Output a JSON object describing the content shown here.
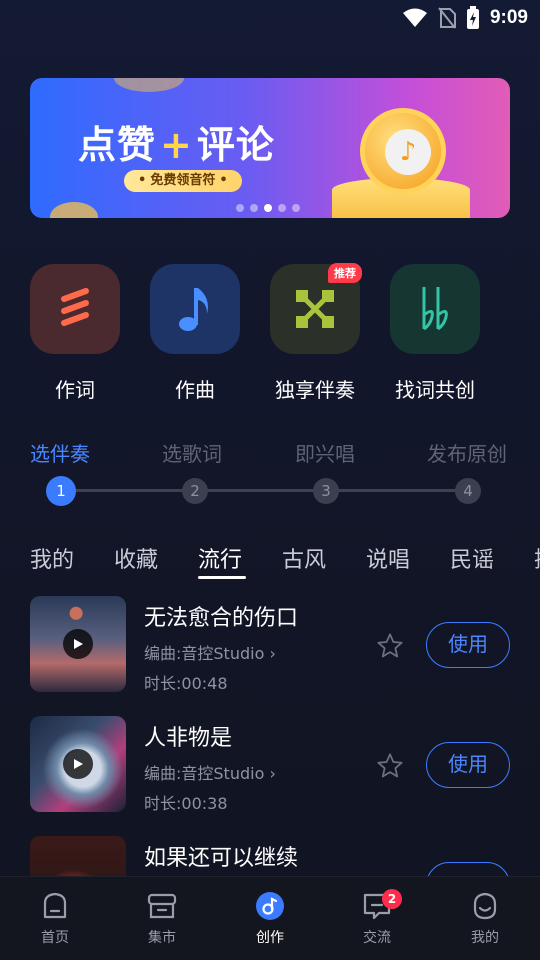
{
  "status_bar": {
    "time": "9:09",
    "icons": [
      "wifi-icon",
      "no-sim-icon",
      "battery-charging-icon"
    ]
  },
  "banner": {
    "headline_left": "点赞",
    "headline_plus": "+",
    "headline_right": "评论",
    "pill_text": "免费领音符",
    "dots_count": 5,
    "active_dot": 3
  },
  "quick_actions": [
    {
      "label": "作词",
      "icon": "lyrics-icon",
      "bg": "#4a2a2e",
      "color": "#ff6a4a"
    },
    {
      "label": "作曲",
      "icon": "music-note-icon",
      "bg": "#1e3366",
      "color": "#4a8fff"
    },
    {
      "label": "独享伴奏",
      "icon": "cross-arrows-icon",
      "bg": "#2b3128",
      "color": "#a8c43a",
      "badge": "推荐"
    },
    {
      "label": "找词共创",
      "icon": "double-flat-icon",
      "bg": "#163631",
      "color": "#36c4a6"
    }
  ],
  "steps": {
    "labels": [
      "选伴奏",
      "选歌词",
      "即兴唱",
      "发布原创"
    ],
    "numbers": [
      "1",
      "2",
      "3",
      "4"
    ],
    "active_index": 0
  },
  "tabs": {
    "items": [
      "我的",
      "收藏",
      "流行",
      "古风",
      "说唱",
      "民谣",
      "摇"
    ],
    "active_index": 2
  },
  "songs": [
    {
      "title": "无法愈合的伤口",
      "composer": "编曲:音控Studio",
      "duration": "时长:00:48",
      "use_label": "使用"
    },
    {
      "title": "人非物是",
      "composer": "编曲:音控Studio",
      "duration": "时长:00:38",
      "use_label": "使用"
    },
    {
      "title": "如果还可以继续",
      "composer": "",
      "duration": "",
      "use_label": ""
    }
  ],
  "bottom_nav": {
    "items": [
      {
        "label": "首页",
        "icon": "home-icon"
      },
      {
        "label": "集市",
        "icon": "market-icon"
      },
      {
        "label": "创作",
        "icon": "create-icon"
      },
      {
        "label": "交流",
        "icon": "chat-icon",
        "badge": "2"
      },
      {
        "label": "我的",
        "icon": "profile-icon"
      }
    ],
    "active_index": 2
  },
  "colors": {
    "accent": "#3b7bff",
    "badge_red": "#ff2d4b"
  }
}
